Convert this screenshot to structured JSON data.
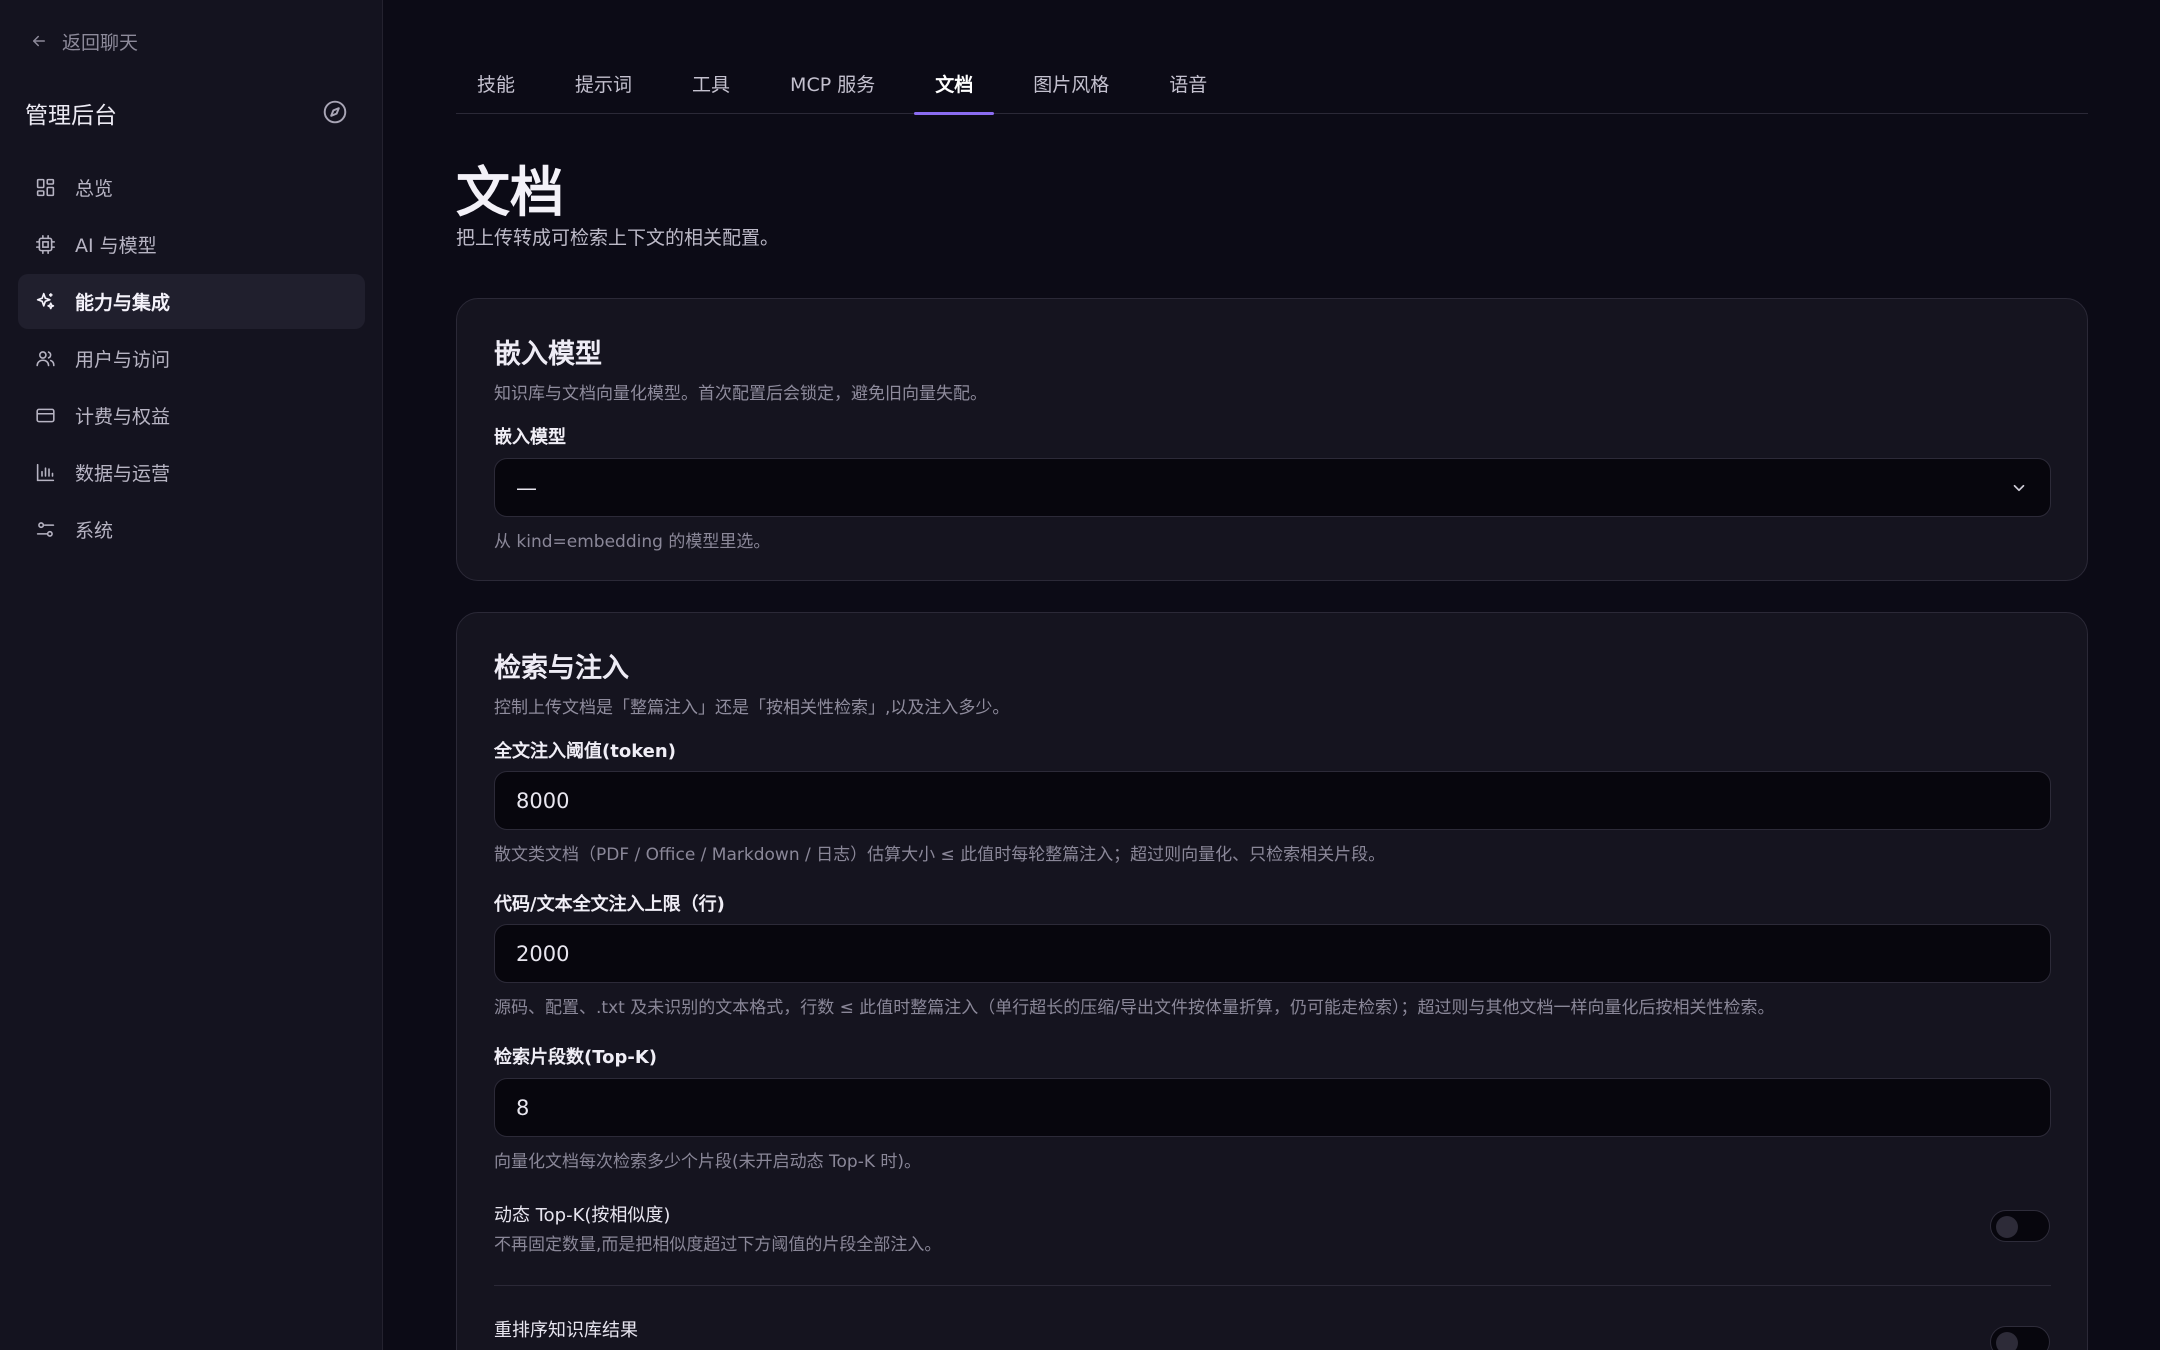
{
  "sidebar": {
    "back_label": "返回聊天",
    "title": "管理后台",
    "items": [
      {
        "label": "总览",
        "icon": "dashboard-icon"
      },
      {
        "label": "AI 与模型",
        "icon": "cpu-icon"
      },
      {
        "label": "能力与集成",
        "icon": "sparkles-icon",
        "active": true
      },
      {
        "label": "用户与访问",
        "icon": "users-icon"
      },
      {
        "label": "计费与权益",
        "icon": "credit-card-icon"
      },
      {
        "label": "数据与运营",
        "icon": "bar-chart-icon"
      },
      {
        "label": "系统",
        "icon": "sliders-icon"
      }
    ]
  },
  "tabs": [
    {
      "label": "技能"
    },
    {
      "label": "提示词"
    },
    {
      "label": "工具"
    },
    {
      "label": "MCP 服务"
    },
    {
      "label": "文档",
      "active": true
    },
    {
      "label": "图片风格"
    },
    {
      "label": "语音"
    }
  ],
  "page": {
    "title": "文档",
    "subtitle": "把上传转成可检索上下文的相关配置。"
  },
  "embedding": {
    "title": "嵌入模型",
    "desc": "知识库与文档向量化模型。首次配置后会锁定，避免旧向量失配。",
    "label": "嵌入模型",
    "value": "—",
    "hint": "从 kind=embedding 的模型里选。"
  },
  "retrieval": {
    "title": "检索与注入",
    "desc": "控制上传文档是「整篇注入」还是「按相关性检索」,以及注入多少。",
    "fulltext_label": "全文注入阈值(token)",
    "fulltext_value": "8000",
    "fulltext_hint": "散文类文档（PDF / Office / Markdown / 日志）估算大小 ≤ 此值时每轮整篇注入；超过则向量化、只检索相关片段。",
    "code_label": "代码/文本全文注入上限（行)",
    "code_value": "2000",
    "code_hint": "源码、配置、.txt 及未识别的文本格式，行数 ≤ 此值时整篇注入（单行超长的压缩/导出文件按体量折算，仍可能走检索）；超过则与其他文档一样向量化后按相关性检索。",
    "topk_label": "检索片段数(Top-K)",
    "topk_value": "8",
    "topk_hint": "向量化文档每次检索多少个片段(未开启动态 Top-K 时)。",
    "dynamic_label": "动态 Top-K(按相似度)",
    "dynamic_desc": "不再固定数量,而是把相似度超过下方阈值的片段全部注入。",
    "dynamic_enabled": false,
    "rerank_label": "重排序知识库结果",
    "rerank_enabled": false
  }
}
